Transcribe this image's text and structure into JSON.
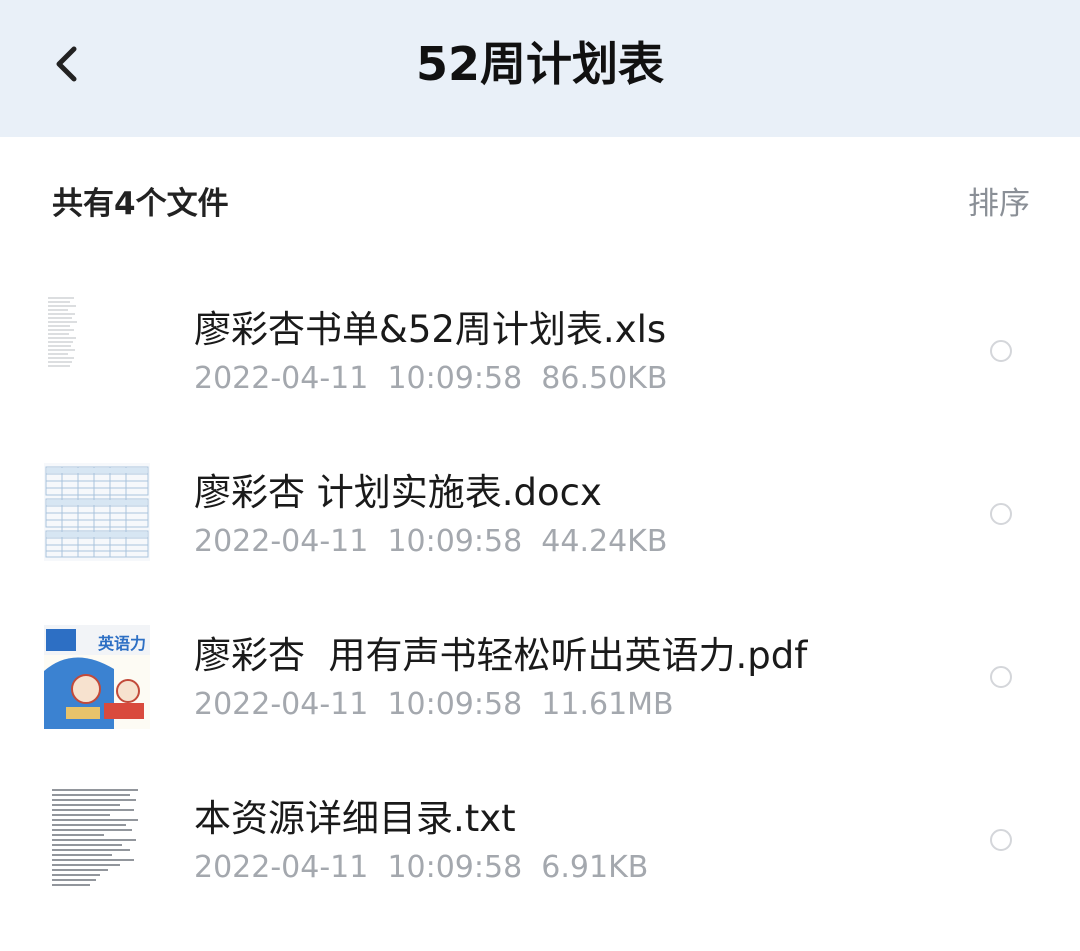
{
  "header": {
    "title": "52周计划表",
    "back_icon": "chevron-left-icon"
  },
  "toolbar": {
    "count_label": "共有4个文件",
    "sort_label": "排序"
  },
  "files": [
    {
      "name": "廖彩杏书单&52周计划表.xls",
      "date": "2022-04-11",
      "time": "10:09:58",
      "size": "86.50KB",
      "thumb_icon": "spreadsheet-thumbnail-icon"
    },
    {
      "name": "廖彩杏 计划实施表.docx",
      "date": "2022-04-11",
      "time": "10:09:58",
      "size": "44.24KB",
      "thumb_icon": "document-table-thumbnail-icon"
    },
    {
      "name": "廖彩杏  用有声书轻松听出英语力.pdf",
      "date": "2022-04-11",
      "time": "10:09:58",
      "size": "11.61MB",
      "thumb_icon": "book-cover-thumbnail-icon",
      "cover_text": "英语力"
    },
    {
      "name": "本资源详细目录.txt",
      "date": "2022-04-11",
      "time": "10:09:58",
      "size": "6.91KB",
      "thumb_icon": "text-file-thumbnail-icon"
    }
  ],
  "colors": {
    "header_bg": "#e9f0f8",
    "text_primary": "#1a1a1a",
    "text_secondary": "#a4a8ae",
    "radio_border": "#d4d6da"
  }
}
